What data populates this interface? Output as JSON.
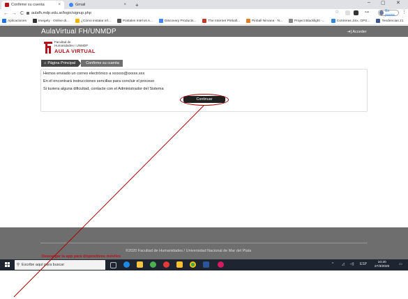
{
  "browser": {
    "tabs": [
      {
        "label": "Confirme su cuenta",
        "active": true,
        "icon": "site-favicon"
      },
      {
        "label": "Gmail",
        "active": false,
        "icon": "google-favicon"
      }
    ],
    "new_tab": "+",
    "url": "aulafh.mdp.edu.ar/login/signup.php",
    "incognito_label": "En pausa",
    "bookmarks": [
      {
        "label": "Aplicaciones",
        "color": "#1a73e8"
      },
      {
        "label": "Imegely · Online di...",
        "color": "#333333"
      },
      {
        "label": "¿Cómo instalar inf...",
        "color": "#f4b400"
      },
      {
        "label": "Postales Intel vs A...",
        "color": "#555555"
      },
      {
        "label": "Discovery Products...",
        "color": "#4285f4"
      },
      {
        "label": "The Internet Pinball...",
        "color": "#c0392b"
      },
      {
        "label": "Pinball Nirvana · N...",
        "color": "#e67e22"
      },
      {
        "label": "Project Blacklight ·...",
        "color": "#888888"
      },
      {
        "label": "Contreras Jinx, GPS...",
        "color": "#2e86de"
      },
      {
        "label": "Tendencias 21",
        "color": "#3b5998"
      }
    ],
    "bookmark_more": "»"
  },
  "site": {
    "brand": "AulaVirtual FH/UNMDP",
    "login": "Acceder",
    "logo_small_1": "Facultad de",
    "logo_small_2": "Humanidades / UNMDP",
    "logo_big": "AULA VIRTUAL",
    "accent": "#b5121b"
  },
  "breadcrumb": {
    "home": "Página Principal",
    "current": "Confirme su cuenta"
  },
  "message": {
    "line1": "Hemos enviado un correo electrónico a  xxxxxx@xxxxx.xxx",
    "line2": "En él encontrará instrucciones sencillas para concluir el proceso",
    "line3": "Si tuviera alguna dificultad, contacte con el Administrador del Sistema",
    "button": "Continuar"
  },
  "footer": {
    "copyright": "©2020 Facultad de Humanidades / Universidad Nacional de Mar del Plata",
    "app_link": "Descargar la app para dispositivos móviles"
  },
  "taskbar": {
    "search_placeholder": "Escribe aquí para buscar",
    "time": "10:20",
    "date": "27/3/2020",
    "lang": "ESP"
  }
}
